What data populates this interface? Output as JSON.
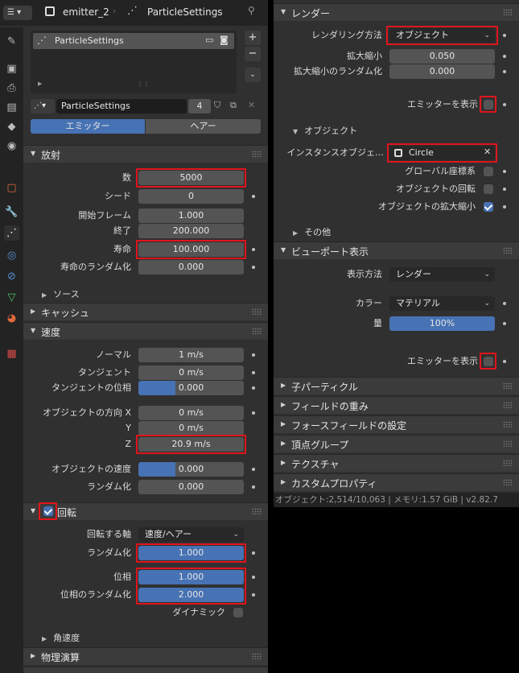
{
  "header": {
    "object": "emitter_2",
    "settings": "ParticleSettings"
  },
  "slot": {
    "name": "ParticleSettings",
    "count": "4"
  },
  "emission_type": {
    "emitter": "エミッター",
    "hair": "ヘアー"
  },
  "emission": {
    "title": "放射",
    "number_label": "数",
    "number": "5000",
    "seed_label": "シード",
    "seed": "0",
    "frame_start_label": "開始フレーム",
    "frame_start": "1.000",
    "frame_end_label": "終了",
    "frame_end": "200.000",
    "lifetime_label": "寿命",
    "lifetime": "100.000",
    "lifetime_random_label": "寿命のランダム化",
    "lifetime_random": "0.000",
    "source_label": "ソース"
  },
  "cache": {
    "title": "キャッシュ"
  },
  "velocity": {
    "title": "速度",
    "normal_label": "ノーマル",
    "normal": "1 m/s",
    "tangent_label": "タンジェント",
    "tangent": "0 m/s",
    "tangent_phase_label": "タンジェントの位相",
    "tangent_phase": "0.000",
    "obj_align_x_label": "オブジェクトの方向 X",
    "obj_align_x": "0 m/s",
    "y_label": "Y",
    "y": "0 m/s",
    "z_label": "Z",
    "z": "20.9 m/s",
    "obj_velocity_label": "オブジェクトの速度",
    "obj_velocity": "0.000",
    "randomize_label": "ランダム化",
    "randomize": "0.000"
  },
  "rotation": {
    "title": "回転",
    "axis_label": "回転する軸",
    "axis": "速度/ヘアー",
    "random_label": "ランダム化",
    "random": "1.000",
    "phase_label": "位相",
    "phase": "1.000",
    "phase_random_label": "位相のランダム化",
    "phase_random": "2.000",
    "dynamic_label": "ダイナミック",
    "angular_label": "角速度"
  },
  "physics": {
    "title": "物理演算"
  },
  "render": {
    "title": "レンダー",
    "render_as_label": "レンダリング方法",
    "render_as": "オブジェクト",
    "scale_label": "拡大縮小",
    "scale": "0.050",
    "scale_random_label": "拡大縮小のランダム化",
    "scale_random": "0.000",
    "show_emitter_label": "エミッターを表示",
    "object_sub": "オブジェクト",
    "instance_label": "インスタンスオブジェ…",
    "instance": "Circle",
    "global_coords_label": "グローバル座標系",
    "obj_rotation_label": "オブジェクトの回転",
    "obj_scale_label": "オブジェクトの拡大縮小",
    "other_sub": "その他"
  },
  "viewport": {
    "title": "ビューポート表示",
    "display_as_label": "表示方法",
    "display_as": "レンダー",
    "color_label": "カラー",
    "color": "マテリアル",
    "amount_label": "量",
    "amount": "100%",
    "show_emitter_label": "エミッターを表示"
  },
  "more_panels": [
    "子パーティクル",
    "フィールドの重み",
    "フォースフィールドの設定",
    "頂点グループ",
    "テクスチャ",
    "カスタムプロパティ"
  ],
  "status": "オブジェクト:2,514/10,063 | メモリ:1.57 GiB | v2.82.7",
  "colors": {
    "accent": "#4772b3",
    "highlight": "#e0151b",
    "bg": "#303030"
  }
}
